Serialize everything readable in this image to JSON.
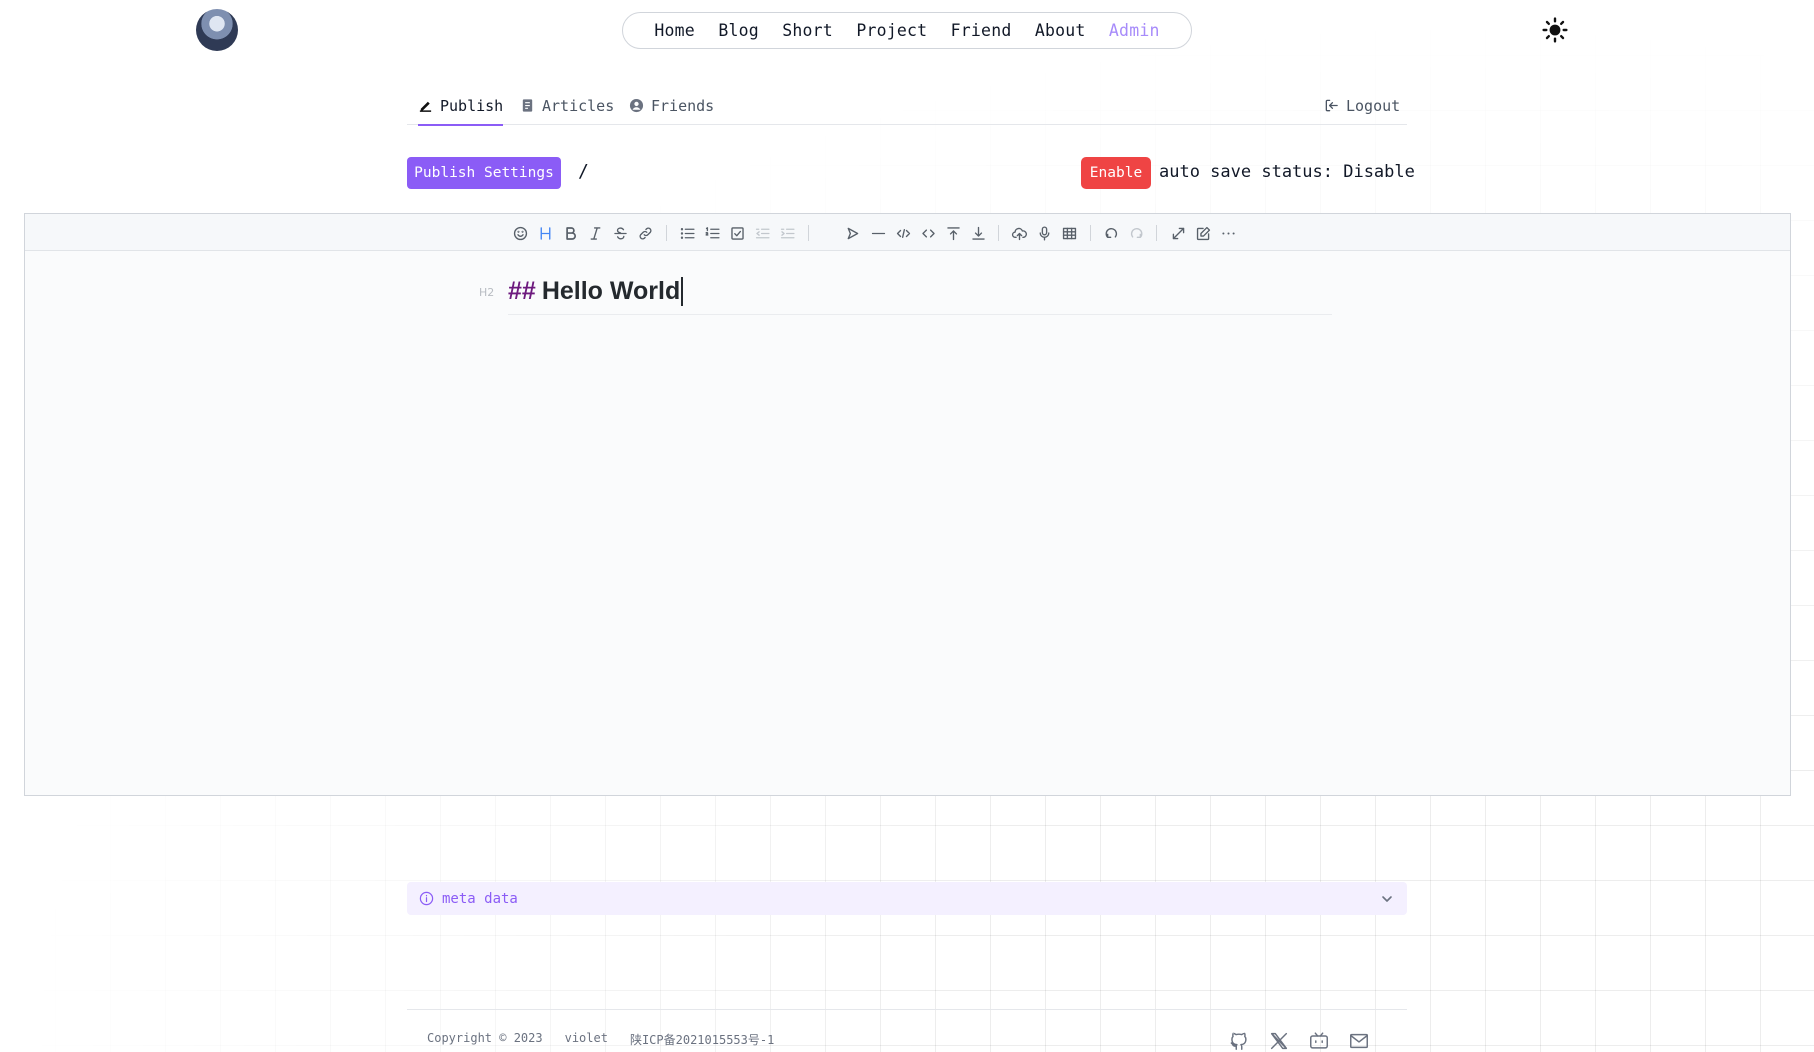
{
  "nav": {
    "items": [
      "Home",
      "Blog",
      "Short",
      "Project",
      "Friend",
      "About",
      "Admin"
    ],
    "active": "Admin"
  },
  "admin_tabs": {
    "publish": "Publish",
    "articles": "Articles",
    "friends": "Friends",
    "logout": "Logout"
  },
  "actions": {
    "publish_settings": "Publish Settings",
    "separator": "/",
    "enable": "Enable",
    "autosave_status": "auto save status: Disable"
  },
  "editor": {
    "heading_marker": "H2",
    "heading_hash": "##",
    "heading_text": "Hello World",
    "toolbar_icons": [
      "emoji-icon",
      "headings-icon",
      "bold-icon",
      "italic-icon",
      "strike-icon",
      "link-icon",
      "list-icon",
      "ordered-list-icon",
      "check-icon",
      "outdent-icon",
      "indent-icon",
      "quote-icon",
      "line-icon",
      "code-icon",
      "inline-code-icon",
      "insert-before-icon",
      "insert-after-icon",
      "upload-icon",
      "record-icon",
      "table-icon",
      "undo-icon",
      "redo-icon",
      "fullscreen-icon",
      "edit-mode-icon",
      "more-icon"
    ]
  },
  "meta": {
    "label": "meta data"
  },
  "footer": {
    "copyright": "Copyright © 2023",
    "author": "violet",
    "icp": "陕ICP备2021015553号-1",
    "icons": [
      "github-icon",
      "x-icon",
      "bilibili-icon",
      "mail-icon"
    ]
  },
  "colors": {
    "accent": "#8b5cf6",
    "enable_button": "#ef4444",
    "nav_active": "#a78bfa"
  }
}
